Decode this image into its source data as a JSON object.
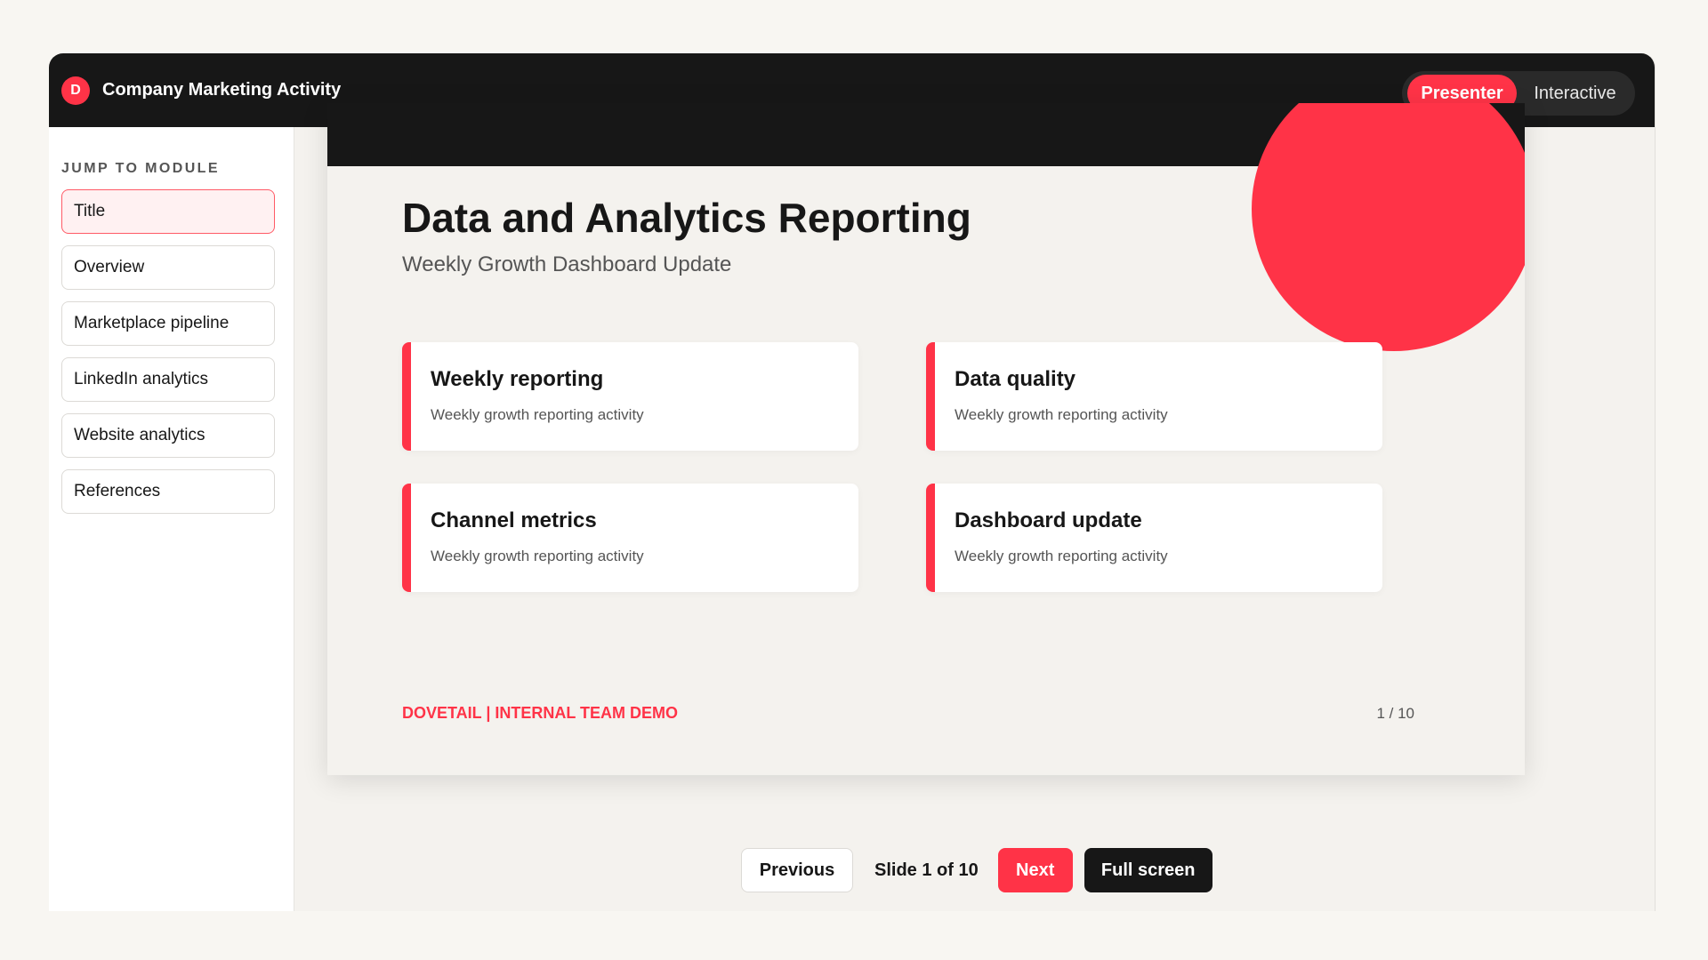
{
  "app": {
    "badge_letter": "D",
    "title": "Company Marketing Activity"
  },
  "mode_toggle": {
    "active_label": "Presenter",
    "inactive_label": "Interactive"
  },
  "sidebar": {
    "heading": "JUMP TO MODULE",
    "items": [
      {
        "label": "Title",
        "active": true
      },
      {
        "label": "Overview",
        "active": false
      },
      {
        "label": "Marketplace pipeline",
        "active": false
      },
      {
        "label": "LinkedIn analytics",
        "active": false
      },
      {
        "label": "Website analytics",
        "active": false
      },
      {
        "label": "References",
        "active": false
      }
    ]
  },
  "slide": {
    "title": "Data and Analytics Reporting",
    "subtitle": "Weekly Growth Dashboard Update",
    "cards": [
      {
        "title": "Weekly reporting",
        "description": "Weekly growth reporting activity"
      },
      {
        "title": "Data quality",
        "description": "Weekly growth reporting activity"
      },
      {
        "title": "Channel metrics",
        "description": "Weekly growth reporting activity"
      },
      {
        "title": "Dashboard update",
        "description": "Weekly growth reporting activity"
      }
    ],
    "footer_left": "DOVETAIL | INTERNAL TEAM DEMO",
    "page_number": "1 / 10"
  },
  "controls": {
    "previous_label": "Previous",
    "slide_indicator": "Slide 1 of 10",
    "next_label": "Next",
    "fullscreen_label": "Full screen"
  },
  "colors": {
    "accent": "#ff3347",
    "dark": "#171717",
    "background": "#f4f2ee"
  }
}
